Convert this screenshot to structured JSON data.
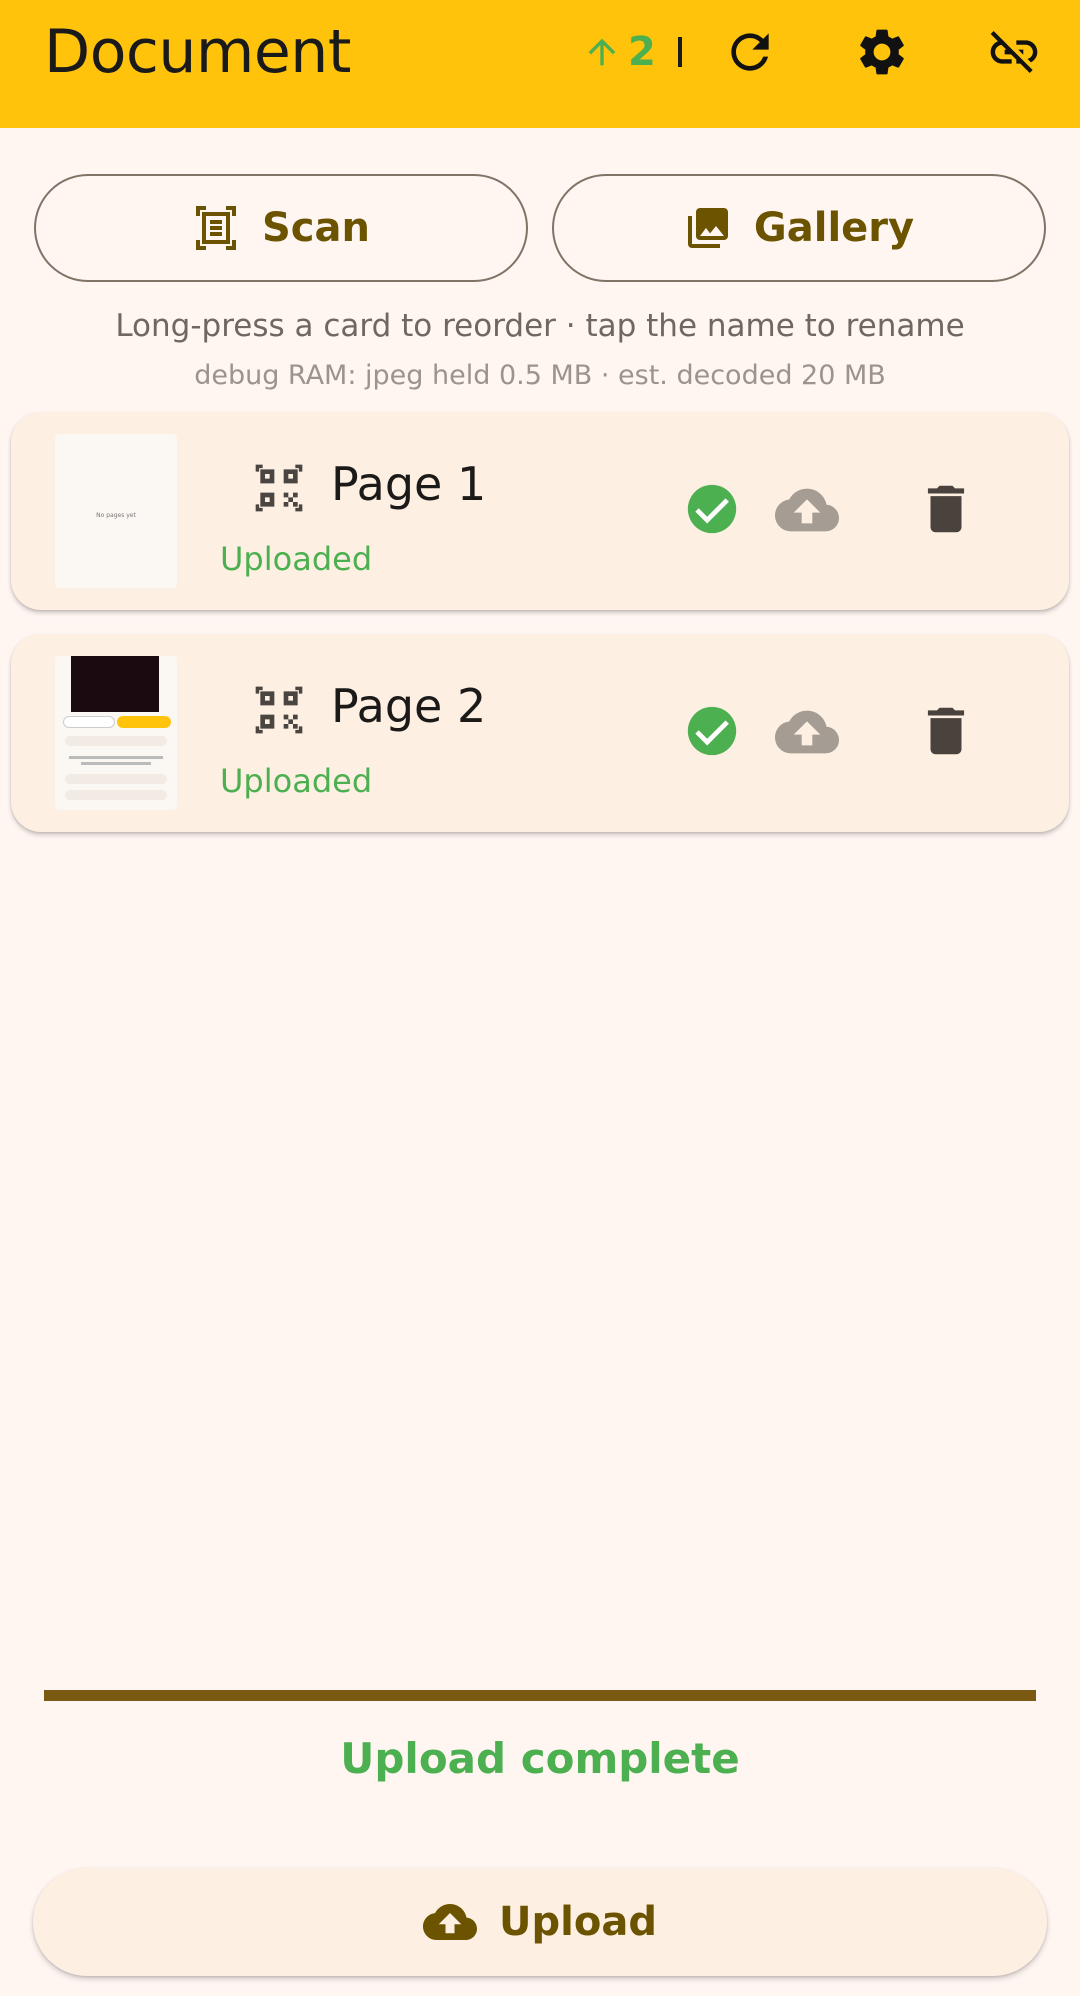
{
  "appbar": {
    "title": "Document",
    "pending_count": "2",
    "icons": [
      "arrow-up-icon",
      "refresh-icon",
      "settings-icon",
      "link-off-icon"
    ]
  },
  "actions": {
    "scan_label": "Scan",
    "gallery_label": "Gallery"
  },
  "hints": {
    "main": "Long-press a card to reorder · tap the name to rename",
    "debug": "debug RAM: jpeg held 0.5 MB · est. decoded 20 MB"
  },
  "pages": [
    {
      "name": "Page 1",
      "status": "Uploaded",
      "thumb_text": "No pages yet"
    },
    {
      "name": "Page 2",
      "status": "Uploaded"
    }
  ],
  "upload": {
    "progress": 1.0,
    "complete_text": "Upload complete",
    "button_label": "Upload"
  },
  "colors": {
    "appbar": "#ffc30c",
    "success": "#4caf50",
    "accent": "#6b5300",
    "background": "#fff6f2",
    "card": "#fdf0e3"
  }
}
